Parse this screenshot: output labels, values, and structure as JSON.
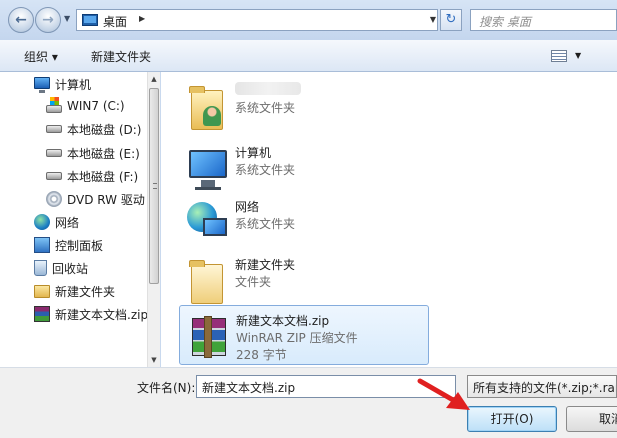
{
  "address": {
    "breadcrumb": "桌面",
    "search_placeholder": "搜索 桌面"
  },
  "toolbar": {
    "organize_label": "组织 ▾",
    "new_folder_label": "新建文件夹"
  },
  "nav": {
    "items": [
      {
        "label": "计算机",
        "icon": "computer-icon"
      },
      {
        "label": "WIN7 (C:)",
        "icon": "system-drive-icon"
      },
      {
        "label": "本地磁盘 (D:)",
        "icon": "drive-icon"
      },
      {
        "label": "本地磁盘 (E:)",
        "icon": "drive-icon"
      },
      {
        "label": "本地磁盘 (F:)",
        "icon": "drive-icon"
      },
      {
        "label": "DVD RW 驱动",
        "icon": "dvd-icon"
      },
      {
        "label": "网络",
        "icon": "network-icon"
      },
      {
        "label": "控制面板",
        "icon": "control-panel-icon"
      },
      {
        "label": "回收站",
        "icon": "recycle-bin-icon"
      },
      {
        "label": "新建文件夹",
        "icon": "folder-icon"
      },
      {
        "label": "新建文本文档.zip",
        "icon": "rar-archive-icon"
      }
    ]
  },
  "files": [
    {
      "name": "",
      "type": "系统文件夹",
      "icon": "user-folder-icon"
    },
    {
      "name": "计算机",
      "type": "系统文件夹",
      "icon": "computer-icon"
    },
    {
      "name": "网络",
      "type": "系统文件夹",
      "icon": "network-icon"
    },
    {
      "name": "新建文件夹",
      "type": "文件夹",
      "icon": "folder-icon"
    },
    {
      "name": "新建文本文档.zip",
      "type": "WinRAR ZIP 压缩文件",
      "size": "228 字节",
      "icon": "rar-archive-icon",
      "selected": true
    }
  ],
  "bottom": {
    "filename_label": "文件名(N):",
    "filename_value": "新建文本文档.zip",
    "filter_value": "所有支持的文件(*.zip;*.rar;",
    "open_label": "打开(O)",
    "cancel_label": "取消"
  },
  "colors": {
    "chrome": "#c9d9ee",
    "selection": "#d8ebfc",
    "annotation_arrow": "#e02020"
  }
}
